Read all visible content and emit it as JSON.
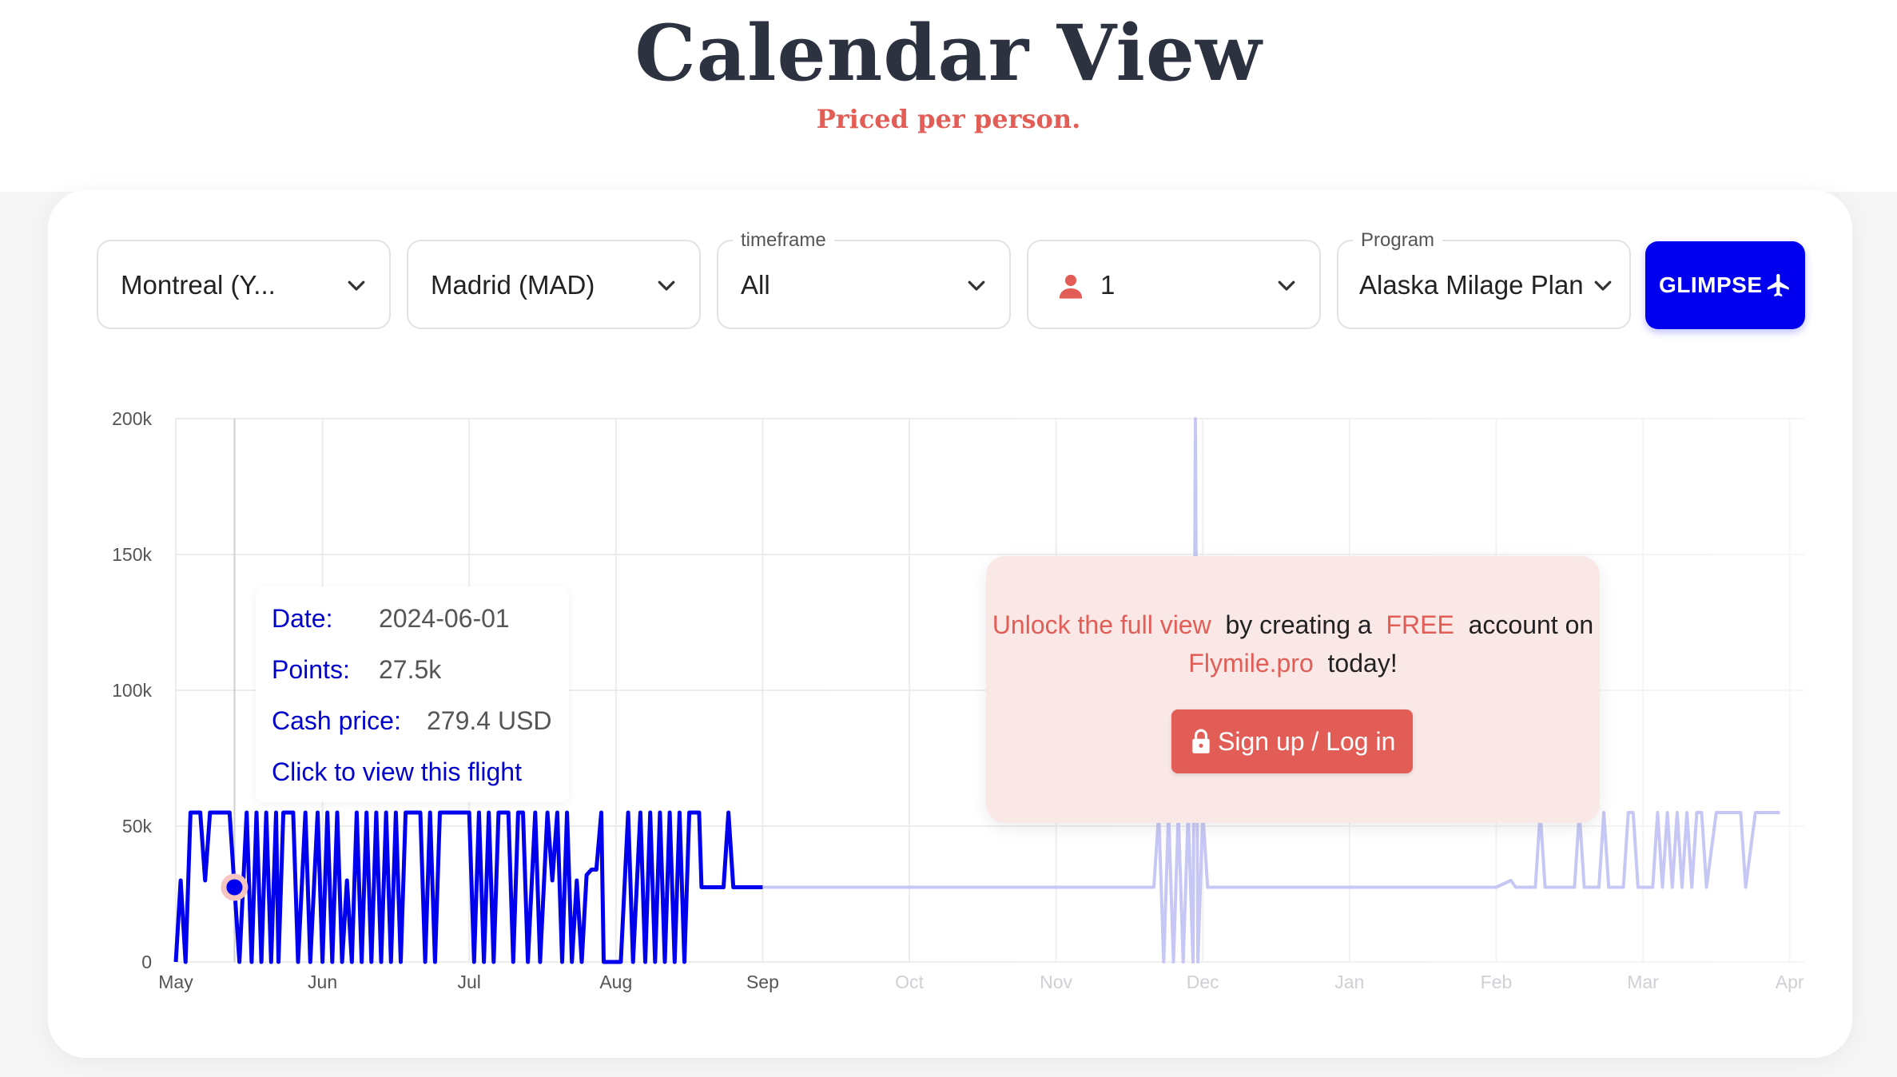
{
  "header": {
    "title": "Calendar View",
    "subtitle": "Priced per person."
  },
  "search": {
    "origin": "Montreal (Y...",
    "destination": "Madrid (MAD)",
    "timeframe_label": "timeframe",
    "timeframe_value": "All",
    "passengers": "1",
    "program_label": "Program",
    "program_value": "Alaska Milage Plan",
    "glimpse_label": "GLIMPSE"
  },
  "colors": {
    "brand_blue": "#0000ee",
    "accent_red": "#e35d57",
    "faded_line": "#c7c7f5"
  },
  "tooltip": {
    "date_label": "Date:",
    "date_value": "2024-06-01",
    "points_label": "Points:",
    "points_value": "27.5k",
    "cash_label": "Cash price:",
    "cash_value": "279.4 USD",
    "link": "Click to view this flight"
  },
  "unlock": {
    "part1": "Unlock the full view",
    "part2": "by creating a",
    "part3": "FREE",
    "part4": "account on",
    "part5": "Flymile.pro",
    "part6": "today!",
    "button": "Sign up / Log in"
  },
  "chart_data": {
    "type": "line",
    "ylim": [
      0,
      200000
    ],
    "y_ticks": [
      "0",
      "50k",
      "100k",
      "150k",
      "200k"
    ],
    "x_ticks": [
      "May",
      "Jun",
      "Jul",
      "Aug",
      "Sep",
      "Oct",
      "Nov",
      "Dec",
      "Jan",
      "Feb",
      "Mar",
      "Apr"
    ],
    "grid": true,
    "highlight": {
      "date": "2024-06-01",
      "points": 27500
    },
    "series": [
      {
        "values": [
          [
            0,
            0
          ],
          [
            0.1,
            30000
          ],
          [
            0.2,
            0
          ],
          [
            0.3,
            55000
          ],
          [
            0.5,
            55000
          ],
          [
            0.6,
            30000
          ],
          [
            0.7,
            55000
          ],
          [
            1.1,
            55000
          ],
          [
            1.2,
            27500
          ],
          [
            1.3,
            0
          ],
          [
            1.45,
            55000
          ],
          [
            1.55,
            0
          ],
          [
            1.65,
            55000
          ],
          [
            1.75,
            0
          ],
          [
            1.85,
            55000
          ],
          [
            1.95,
            0
          ],
          [
            2.05,
            55000
          ],
          [
            2.1,
            0
          ],
          [
            2.2,
            55000
          ],
          [
            2.4,
            55000
          ],
          [
            2.5,
            0
          ],
          [
            2.65,
            55000
          ],
          [
            2.75,
            0
          ],
          [
            2.9,
            55000
          ],
          [
            3.0,
            0
          ],
          [
            3.1,
            55000
          ],
          [
            3.2,
            0
          ],
          [
            3.3,
            55000
          ],
          [
            3.4,
            0
          ],
          [
            3.5,
            30000
          ],
          [
            3.6,
            0
          ],
          [
            3.7,
            55000
          ],
          [
            3.8,
            0
          ],
          [
            3.9,
            55000
          ],
          [
            4.0,
            0
          ],
          [
            4.1,
            55000
          ],
          [
            4.2,
            0
          ],
          [
            4.3,
            55000
          ],
          [
            4.4,
            0
          ],
          [
            4.5,
            55000
          ],
          [
            4.6,
            0
          ],
          [
            4.7,
            55000
          ],
          [
            5.0,
            55000
          ],
          [
            5.1,
            0
          ],
          [
            5.2,
            55000
          ],
          [
            5.3,
            0
          ],
          [
            5.4,
            55000
          ],
          [
            6.0,
            55000
          ],
          [
            6.1,
            0
          ],
          [
            6.2,
            55000
          ],
          [
            6.3,
            0
          ],
          [
            6.4,
            55000
          ],
          [
            6.5,
            0
          ],
          [
            6.6,
            55000
          ],
          [
            6.8,
            55000
          ],
          [
            6.9,
            0
          ],
          [
            7.0,
            55000
          ],
          [
            7.1,
            55000
          ],
          [
            7.2,
            0
          ],
          [
            7.35,
            55000
          ],
          [
            7.45,
            0
          ],
          [
            7.6,
            55000
          ],
          [
            7.7,
            30000
          ],
          [
            7.8,
            55000
          ],
          [
            7.9,
            0
          ],
          [
            8.0,
            55000
          ],
          [
            8.1,
            0
          ],
          [
            8.2,
            30000
          ],
          [
            8.3,
            0
          ],
          [
            8.4,
            32000
          ],
          [
            8.5,
            34000
          ],
          [
            8.6,
            34000
          ],
          [
            8.7,
            55000
          ],
          [
            8.75,
            0
          ],
          [
            9.0,
            0
          ],
          [
            9.1,
            0
          ],
          [
            9.25,
            55000
          ],
          [
            9.35,
            0
          ],
          [
            9.5,
            55000
          ],
          [
            9.6,
            0
          ],
          [
            9.7,
            55000
          ],
          [
            9.8,
            0
          ],
          [
            9.9,
            55000
          ],
          [
            10.0,
            0
          ],
          [
            10.1,
            55000
          ],
          [
            10.2,
            0
          ],
          [
            10.3,
            55000
          ],
          [
            10.4,
            0
          ],
          [
            10.5,
            55000
          ],
          [
            10.7,
            55000
          ],
          [
            10.75,
            27500
          ],
          [
            11.0,
            27500
          ],
          [
            11.1,
            27500
          ],
          [
            11.2,
            27500
          ],
          [
            11.3,
            55000
          ],
          [
            11.4,
            27500
          ],
          [
            12.0,
            27500
          ],
          [
            14.0,
            27500
          ],
          [
            16.0,
            27500
          ],
          [
            18.0,
            27500
          ],
          [
            19.5,
            27500
          ],
          [
            20.0,
            27500
          ],
          [
            20.1,
            55000
          ],
          [
            20.2,
            0
          ],
          [
            20.3,
            55000
          ],
          [
            20.4,
            0
          ],
          [
            20.5,
            55000
          ],
          [
            20.6,
            0
          ],
          [
            20.7,
            55000
          ],
          [
            20.8,
            0
          ],
          [
            20.85,
            200000
          ],
          [
            20.9,
            0
          ],
          [
            21.0,
            55000
          ],
          [
            21.1,
            27500
          ],
          [
            22.0,
            27500
          ],
          [
            23.0,
            27500
          ],
          [
            23.5,
            27500
          ],
          [
            24.0,
            27500
          ],
          [
            25.0,
            27500
          ],
          [
            26.0,
            27500
          ],
          [
            27.0,
            27500
          ],
          [
            27.3,
            30000
          ],
          [
            27.4,
            27500
          ],
          [
            27.8,
            27500
          ],
          [
            27.9,
            55000
          ],
          [
            28.0,
            27500
          ],
          [
            28.6,
            27500
          ],
          [
            28.7,
            55000
          ],
          [
            28.8,
            27500
          ],
          [
            29.1,
            27500
          ],
          [
            29.2,
            55000
          ],
          [
            29.3,
            27500
          ],
          [
            29.6,
            27500
          ],
          [
            29.7,
            55000
          ],
          [
            29.8,
            55000
          ],
          [
            29.9,
            27500
          ],
          [
            30.2,
            27500
          ],
          [
            30.3,
            55000
          ],
          [
            30.4,
            27500
          ],
          [
            30.5,
            55000
          ],
          [
            30.6,
            27500
          ],
          [
            30.7,
            55000
          ],
          [
            30.8,
            27500
          ],
          [
            30.9,
            55000
          ],
          [
            31.0,
            27500
          ],
          [
            31.1,
            55000
          ],
          [
            31.2,
            55000
          ],
          [
            31.3,
            27500
          ],
          [
            31.5,
            55000
          ],
          [
            32.0,
            55000
          ],
          [
            32.1,
            27500
          ],
          [
            32.3,
            55000
          ],
          [
            32.8,
            55000
          ]
        ]
      }
    ]
  }
}
